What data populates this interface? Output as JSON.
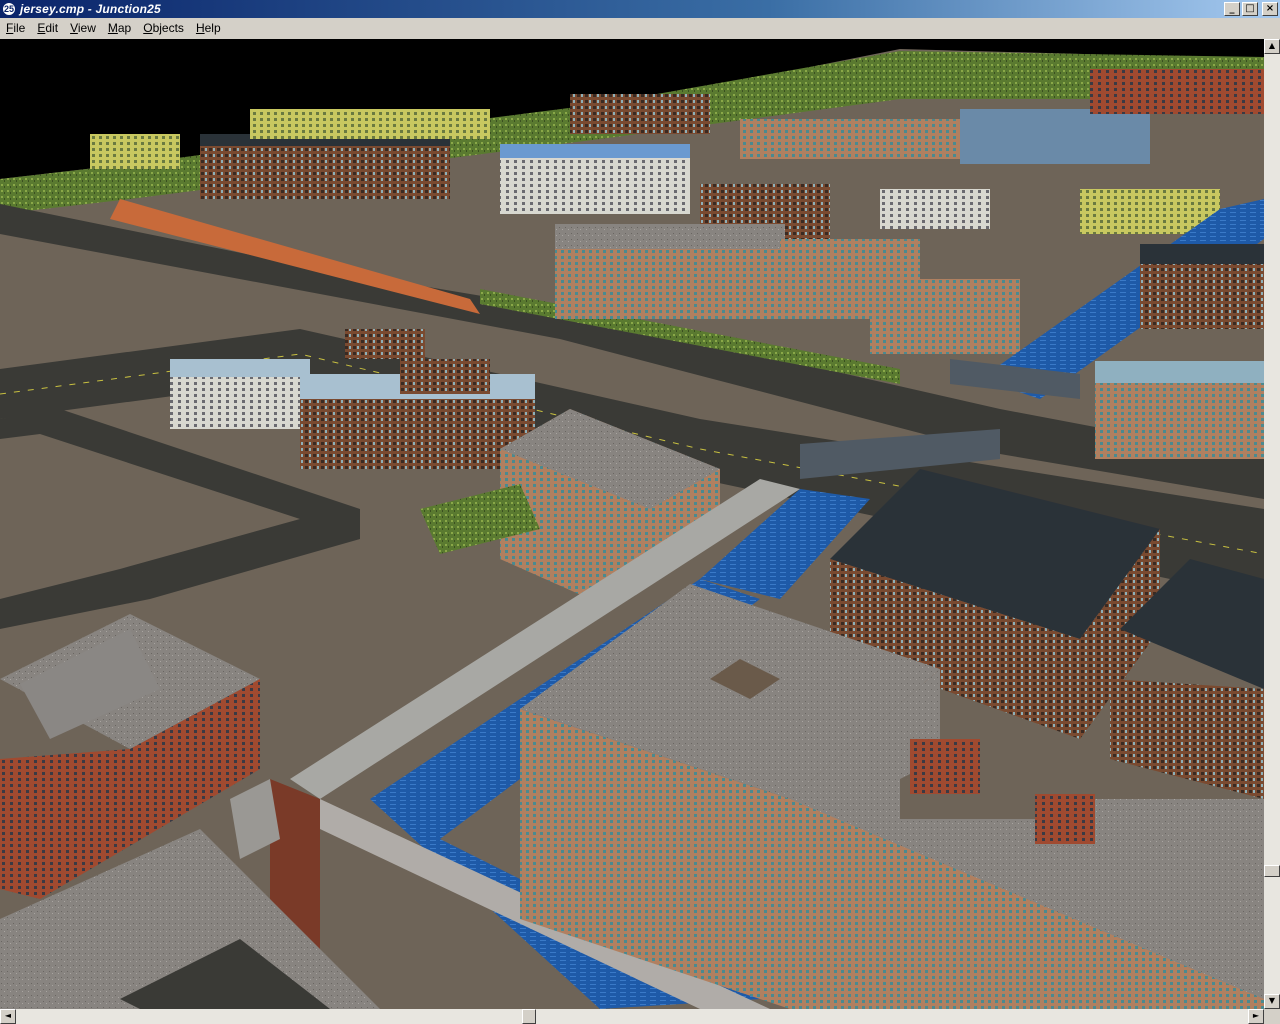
{
  "window": {
    "icon_label": "25",
    "title": "jersey.cmp - Junction25",
    "buttons": {
      "minimize": "_",
      "maximize": "□",
      "close": "×"
    }
  },
  "menu": {
    "items": [
      {
        "label": "File",
        "accel": "F",
        "rest": "ile"
      },
      {
        "label": "Edit",
        "accel": "E",
        "rest": "dit"
      },
      {
        "label": "View",
        "accel": "V",
        "rest": "iew"
      },
      {
        "label": "Map",
        "accel": "M",
        "rest": "ap"
      },
      {
        "label": "Objects",
        "accel": "O",
        "rest": "bjects"
      },
      {
        "label": "Help",
        "accel": "H",
        "rest": "elp"
      }
    ]
  },
  "scrollbars": {
    "vertical": {
      "up": "▲",
      "down": "▼",
      "position": 0.86,
      "thumb_fraction": 0.01
    },
    "horizontal": {
      "left": "◄",
      "right": "►",
      "position": 0.41,
      "thumb_fraction": 0.01
    }
  },
  "colors": {
    "titlebar_start": "#0a246a",
    "titlebar_end": "#a6caf0",
    "window_chrome": "#d4d0c8",
    "sky": "#000000",
    "ground": "#6e6458",
    "road": "#3a3a36",
    "water": "#1e5aa8",
    "grass": "#6a8a3a",
    "brick": "#7a4a30",
    "roof_gray": "#8a8784",
    "roof_dark": "#2a3238"
  }
}
